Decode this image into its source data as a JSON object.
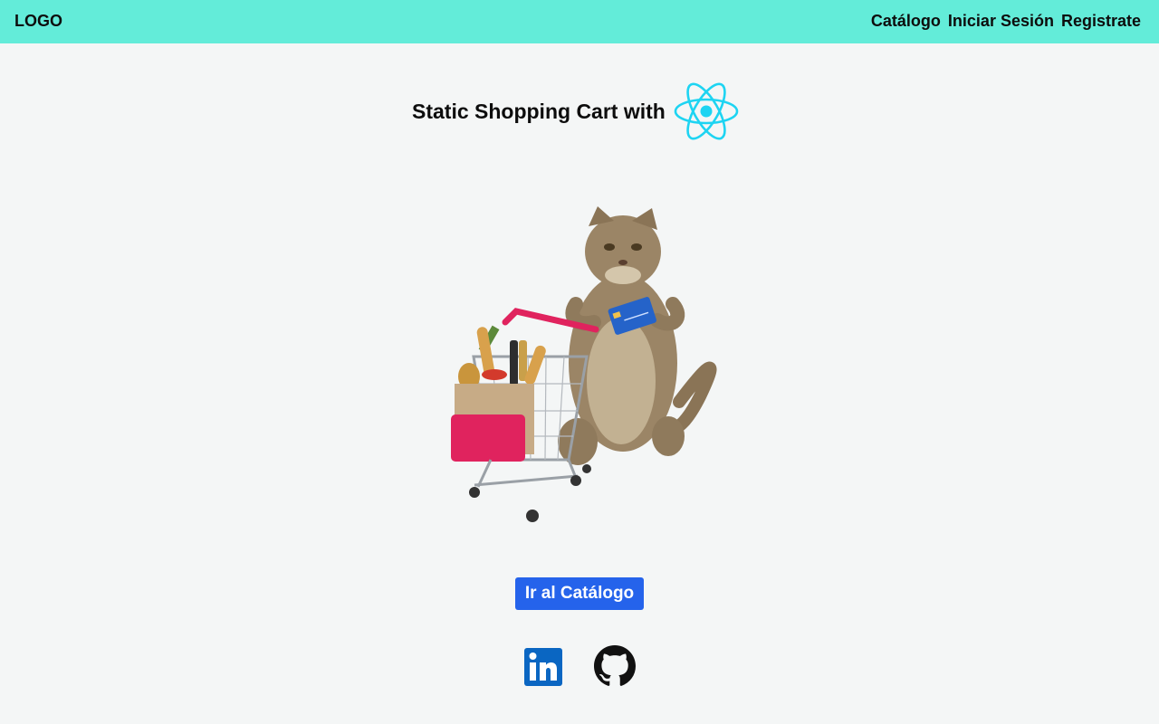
{
  "navbar": {
    "logo": "LOGO",
    "links": [
      {
        "label": "Catálogo"
      },
      {
        "label": "Iniciar Sesión"
      },
      {
        "label": "Registrate"
      }
    ],
    "background": "#63ecd9"
  },
  "hero": {
    "title": "Static Shopping Cart with",
    "title_icon": "react-logo-icon",
    "react_color": "#1dd4f2",
    "illustration": "cat-pushing-shopping-cart-image"
  },
  "cta": {
    "label": "Ir al Catálogo",
    "color": "#2563eb"
  },
  "social": [
    {
      "icon": "linkedin-icon",
      "color": "#0a66c2"
    },
    {
      "icon": "github-icon",
      "color": "#111111"
    }
  ]
}
